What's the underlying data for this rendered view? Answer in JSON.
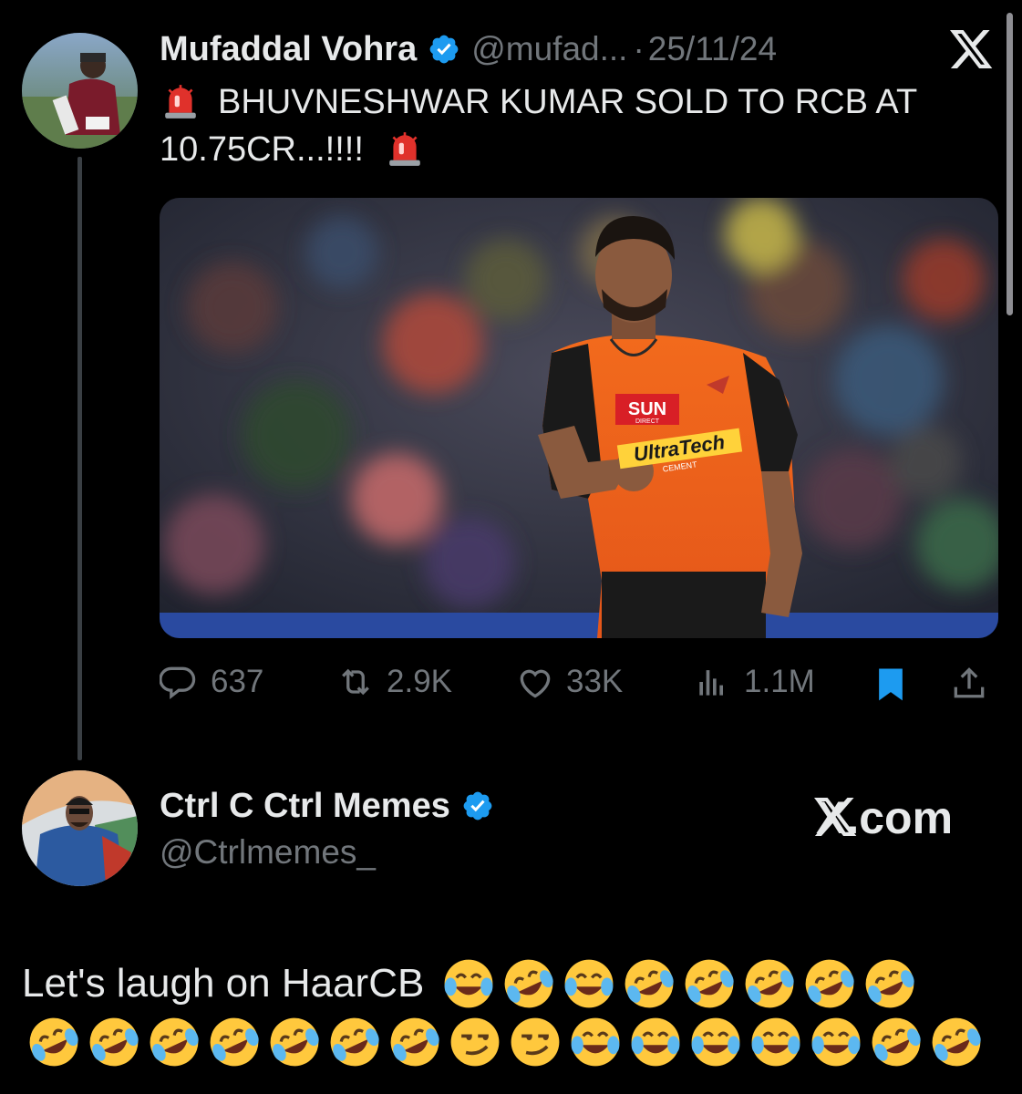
{
  "tweet1": {
    "author_name": "Mufaddal Vohra",
    "handle": "@mufad...",
    "separator": "·",
    "date": "25/11/24",
    "line1": "BHUVNESHWAR KUMAR SOLD TO RCB AT",
    "line2": "10.75CR...!!!!",
    "emoji_icon": "police-siren-icon",
    "brand_icon": "x-logo-icon",
    "media_icon": "cricket-player-photo",
    "jersey_text": {
      "sponsor1": "SUN",
      "sponsor1_sub": "DIRECT",
      "sponsor2": "UltraTech",
      "sponsor2_sub": "CEMENT"
    },
    "stats": {
      "replies": "637",
      "reposts": "2.9K",
      "likes": "33K",
      "views": "1.1M"
    }
  },
  "tweet2": {
    "author_name": "Ctrl C Ctrl Memes",
    "handle": "@Ctrlmemes_",
    "brand_label": "X.com",
    "text": "Let's laugh on HaarCB",
    "emoji_line1": [
      "joy",
      "rofl",
      "joy",
      "rofl",
      "rofl",
      "rofl",
      "rofl",
      "rofl"
    ],
    "emoji_line2": [
      "rofl",
      "rofl",
      "rofl",
      "rofl",
      "rofl",
      "rofl",
      "rofl",
      "smirk",
      "smirk",
      "joy",
      "joy",
      "joy",
      "joy",
      "joy",
      "rofl",
      "rofl"
    ]
  },
  "colors": {
    "background": "#000000",
    "text": "#e7e9ea",
    "muted": "#71767b",
    "verified": "#1d9bf0",
    "bookmark": "#1d9bf0"
  }
}
